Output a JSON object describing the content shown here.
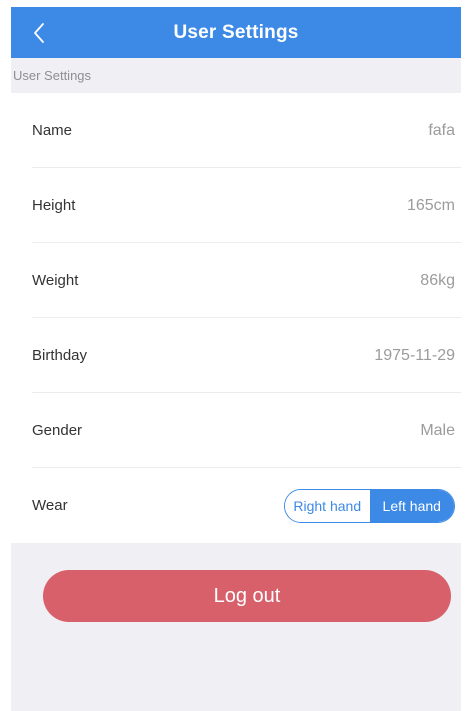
{
  "nav": {
    "title": "User Settings"
  },
  "section": {
    "header": "User Settings"
  },
  "rows": [
    {
      "label": "Name",
      "value": "fafa"
    },
    {
      "label": "Height",
      "value": "165cm"
    },
    {
      "label": "Weight",
      "value": "86kg"
    },
    {
      "label": "Birthday",
      "value": "1975-11-29"
    },
    {
      "label": "Gender",
      "value": "Male"
    }
  ],
  "wear": {
    "label": "Wear",
    "options": [
      "Right hand",
      "Left hand"
    ],
    "selected": "Left hand"
  },
  "logout": {
    "label": "Log out"
  },
  "icons": {
    "back": "chevron-left-icon"
  },
  "colors": {
    "accent": "#3d8ae6",
    "logout": "#d8606a",
    "background": "#efeff4"
  }
}
